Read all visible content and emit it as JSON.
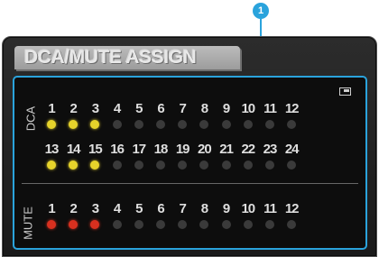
{
  "callout": "1",
  "title": "DCA/MUTE ASSIGN",
  "dca": {
    "label": "DCA",
    "rows": [
      [
        {
          "n": "1",
          "on": true
        },
        {
          "n": "2",
          "on": true
        },
        {
          "n": "3",
          "on": true
        },
        {
          "n": "4",
          "on": false
        },
        {
          "n": "5",
          "on": false
        },
        {
          "n": "6",
          "on": false
        },
        {
          "n": "7",
          "on": false
        },
        {
          "n": "8",
          "on": false
        },
        {
          "n": "9",
          "on": false
        },
        {
          "n": "10",
          "on": false
        },
        {
          "n": "11",
          "on": false
        },
        {
          "n": "12",
          "on": false
        }
      ],
      [
        {
          "n": "13",
          "on": true
        },
        {
          "n": "14",
          "on": true
        },
        {
          "n": "15",
          "on": true
        },
        {
          "n": "16",
          "on": false
        },
        {
          "n": "17",
          "on": false
        },
        {
          "n": "18",
          "on": false
        },
        {
          "n": "19",
          "on": false
        },
        {
          "n": "20",
          "on": false
        },
        {
          "n": "21",
          "on": false
        },
        {
          "n": "22",
          "on": false
        },
        {
          "n": "23",
          "on": false
        },
        {
          "n": "24",
          "on": false
        }
      ]
    ]
  },
  "mute": {
    "label": "MUTE",
    "rows": [
      [
        {
          "n": "1",
          "on": true
        },
        {
          "n": "2",
          "on": true
        },
        {
          "n": "3",
          "on": true
        },
        {
          "n": "4",
          "on": false
        },
        {
          "n": "5",
          "on": false
        },
        {
          "n": "6",
          "on": false
        },
        {
          "n": "7",
          "on": false
        },
        {
          "n": "8",
          "on": false
        },
        {
          "n": "9",
          "on": false
        },
        {
          "n": "10",
          "on": false
        },
        {
          "n": "11",
          "on": false
        },
        {
          "n": "12",
          "on": false
        }
      ]
    ]
  },
  "colors": {
    "dca_on": "#e6d32b",
    "mute_on": "#d8301f",
    "off": "#3a3a3a",
    "accent": "#2aa3dc"
  }
}
